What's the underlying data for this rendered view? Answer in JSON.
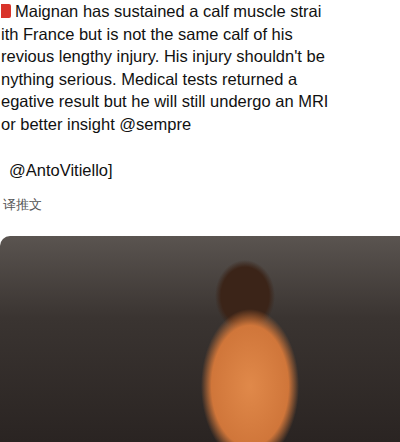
{
  "tweet": {
    "lines": [
      "Maignan has sustained a calf muscle strai",
      "ith France but is not the same calf of his",
      "revious lengthy injury. His injury shouldn't be",
      "nything serious. Medical tests returned a",
      "egative result but he will still undergo an MRI",
      "or better insight @sempre"
    ],
    "credit": "@AntoVitiello]",
    "translate_link": "译推文"
  }
}
